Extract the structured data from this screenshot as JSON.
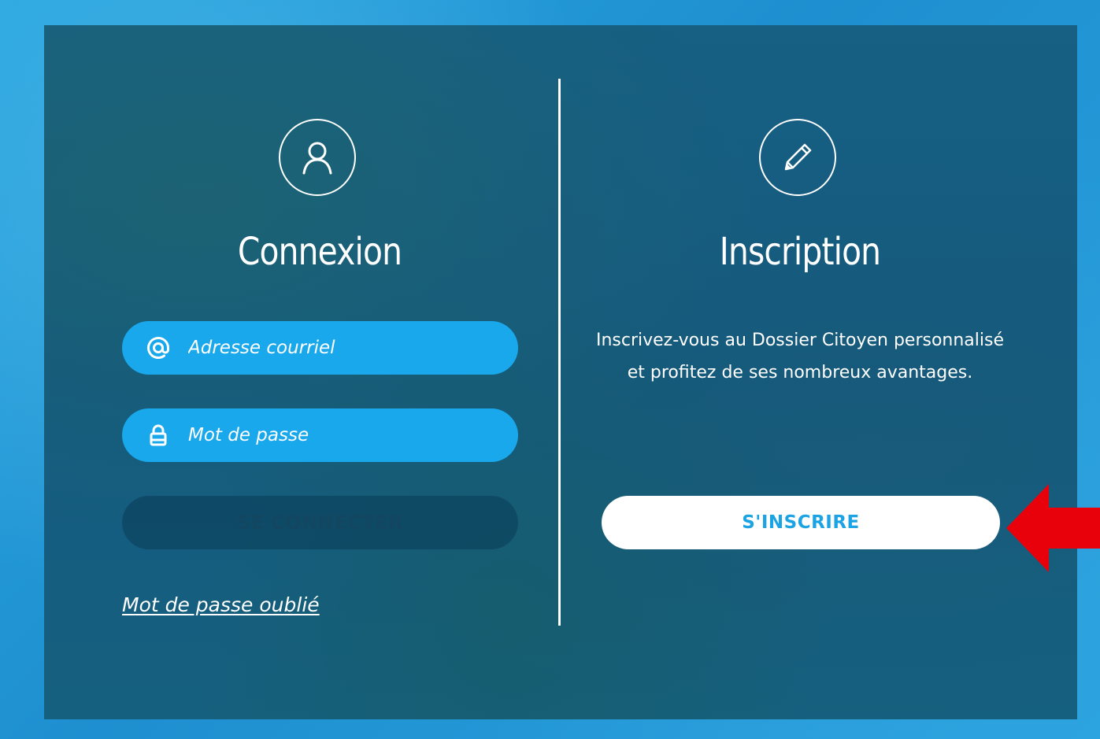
{
  "login": {
    "title": "Connexion",
    "icon": "user-icon",
    "email": {
      "placeholder": "Adresse courriel",
      "value": "",
      "icon": "at-sign-icon"
    },
    "password": {
      "placeholder": "Mot de passe",
      "value": "",
      "icon": "lock-icon"
    },
    "submit_label": "SE CONNECTER",
    "forgot_label": "Mot de passe oublié"
  },
  "signup": {
    "title": "Inscription",
    "icon": "pencil-icon",
    "description": "Inscrivez-vous au Dossier Citoyen personnalisé et profitez de ses nombreux avantages.",
    "button_label": "S'INSCRIRE"
  },
  "annotation": {
    "type": "arrow",
    "color": "#e8000b",
    "points_to": "S'INSCRIRE"
  },
  "colors": {
    "accent": "#19a8ec",
    "panel": "#155d82",
    "annotation": "#e8000b"
  }
}
